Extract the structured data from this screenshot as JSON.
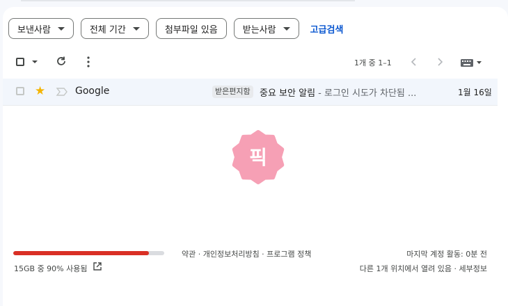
{
  "filters": {
    "chips": [
      {
        "label": "보낸사람"
      },
      {
        "label": "전체 기간"
      },
      {
        "label": "첨부파일 있음"
      },
      {
        "label": "받는사람"
      }
    ],
    "advanced_search": "고급검색"
  },
  "toolbar": {
    "pagination": "1개 중 1–1",
    "icons": [
      "select-checkbox",
      "refresh-icon",
      "more-icon",
      "prev-page-icon",
      "next-page-icon",
      "keyboard-icon"
    ]
  },
  "email": {
    "starred": true,
    "sender": "Google",
    "label": "받은편지함",
    "subject": "중요 보안 알림",
    "snippet": " - 로그인 시도가 차단됨 ...",
    "date": "1월 16일"
  },
  "badge": {
    "text": "픽",
    "color": "#f6a0b5"
  },
  "storage": {
    "used_fraction": 0.9,
    "text": "15GB 중 90% 사용됨",
    "bar_color": "#d93025"
  },
  "footer": {
    "links": "약관 · 개인정보처리방침 · 프로그램 정책",
    "last_activity": "마지막 계정 활동: 0분 전",
    "other_sessions": "다른 1개 위치에서 열려 있음 · 세부정보"
  },
  "colors": {
    "accent": "#0b57d0",
    "star": "#f4b400",
    "row_bg": "#f2f6fc"
  }
}
